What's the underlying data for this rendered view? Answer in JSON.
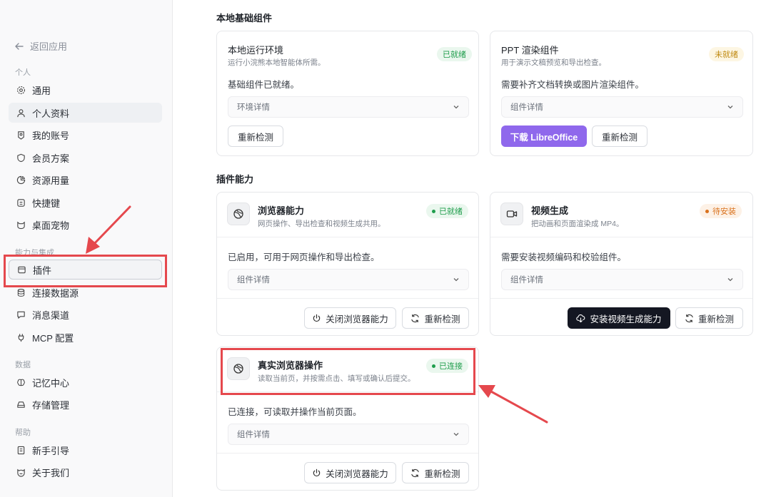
{
  "sidebar": {
    "back_label": "返回应用",
    "groups": {
      "personal": "个人",
      "integration": "能力与集成",
      "data": "数据",
      "help": "帮助"
    },
    "items": {
      "general": "通用",
      "profile": "个人资料",
      "account": "我的账号",
      "membership": "会员方案",
      "usage": "资源用量",
      "shortcuts": "快捷键",
      "pet": "桌面宠物",
      "plugins": "插件",
      "datasource": "连接数据源",
      "channels": "消息渠道",
      "mcp": "MCP 配置",
      "memory": "记忆中心",
      "storage": "存储管理",
      "guide": "新手引导",
      "about": "关于我们"
    }
  },
  "local": {
    "section_title": "本地基础组件",
    "runtime": {
      "title": "本地运行环境",
      "sub": "运行小浣熊本地智能体所需。",
      "badge": "已就绪",
      "desc": "基础组件已就绪。",
      "details": "环境详情",
      "recheck": "重新检测"
    },
    "ppt": {
      "title": "PPT 渲染组件",
      "sub": "用于演示文稿预览和导出检查。",
      "badge": "未就绪",
      "desc": "需要补齐文档转换或图片渲染组件。",
      "details": "组件详情",
      "download": "下载 LibreOffice",
      "recheck": "重新检测"
    }
  },
  "plugins": {
    "section_title": "插件能力",
    "browser": {
      "title": "浏览器能力",
      "sub": "网页操作、导出检查和视频生成共用。",
      "badge": "已就绪",
      "desc": "已启用，可用于网页操作和导出检查。",
      "details": "组件详情",
      "disable": "关闭浏览器能力",
      "recheck": "重新检测"
    },
    "video": {
      "title": "视频生成",
      "sub": "把动画和页面渲染成 MP4。",
      "badge": "待安装",
      "desc": "需要安装视频编码和校验组件。",
      "details": "组件详情",
      "install": "安装视频生成能力",
      "recheck": "重新检测"
    },
    "real_browser": {
      "title": "真实浏览器操作",
      "sub": "读取当前页，并按需点击、填写或确认后提交。",
      "badge": "已连接",
      "desc": "已连接，可读取并操作当前页面。",
      "details": "组件详情",
      "disable": "关闭浏览器能力",
      "recheck": "重新检测"
    }
  },
  "colors": {
    "accent_purple": "#8f68ec",
    "annotation_red": "#e5484d",
    "ready_green": "#1f9d4c",
    "pending_orange": "#d9711c"
  }
}
